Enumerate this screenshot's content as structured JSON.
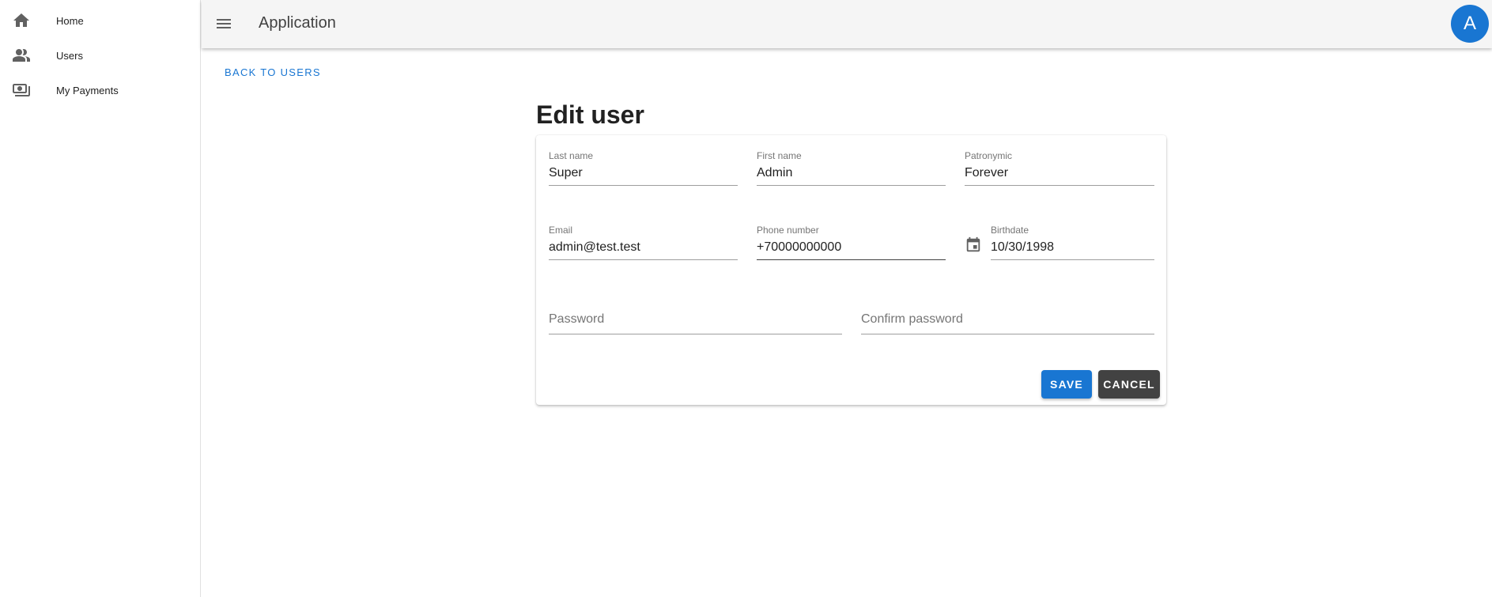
{
  "sidebar": {
    "items": [
      {
        "label": "Home",
        "icon": "home-icon"
      },
      {
        "label": "Users",
        "icon": "people-icon"
      },
      {
        "label": "My Payments",
        "icon": "payments-icon"
      }
    ]
  },
  "appbar": {
    "title": "Application",
    "avatar_letter": "A",
    "avatar_color": "#1976d2"
  },
  "back_link": "BACK TO USERS",
  "page_title": "Edit user",
  "form": {
    "last_name": {
      "label": "Last name",
      "value": "Super"
    },
    "first_name": {
      "label": "First name",
      "value": "Admin"
    },
    "patronymic": {
      "label": "Patronymic",
      "value": "Forever"
    },
    "email": {
      "label": "Email",
      "value": "admin@test.test"
    },
    "phone": {
      "label": "Phone number",
      "value": "+70000000000"
    },
    "birthdate": {
      "label": "Birthdate",
      "value": "10/30/1998"
    },
    "password": {
      "placeholder": "Password"
    },
    "confirm_password": {
      "placeholder": "Confirm password"
    },
    "save_label": "SAVE",
    "cancel_label": "CANCEL"
  },
  "colors": {
    "primary": "#1976d2",
    "cancel": "#424242",
    "appbar_bg": "#f5f5f5"
  }
}
